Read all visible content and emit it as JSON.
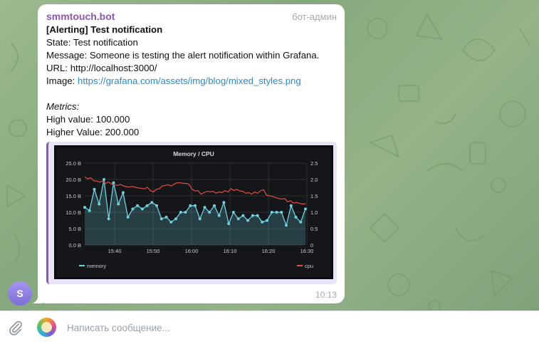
{
  "message": {
    "sender": "smmtouch.bot",
    "role_tag": "бот-админ",
    "avatar_letter": "S",
    "title": "[Alerting] Test notification",
    "state": "State: Test notification",
    "message_line": "Message: Someone is testing the alert notification within Grafana.",
    "url_line": "URL: http://localhost:3000/",
    "image_prefix": "Image: ",
    "image_link": "https://grafana.com/assets/img/blog/mixed_styles.png",
    "metrics_label": "Metrics:",
    "high_value": "High value: 100.000",
    "higher_value": "Higher Value: 200.000",
    "time": "10:13"
  },
  "input": {
    "placeholder": "Написать сообщение..."
  },
  "colors": {
    "sender": "#8e55b8",
    "link": "#2a8ad0",
    "memory_series": "#6ed0e0",
    "cpu_series": "#e24d42",
    "chart_bg": "#141619"
  },
  "chart_data": {
    "type": "line",
    "title": "Memory / CPU",
    "x_ticks": [
      "15:40",
      "15:50",
      "16:00",
      "16:10",
      "16:20",
      "16:30"
    ],
    "y_left_ticks": [
      "0.0 B",
      "5.0 B",
      "10.0 B",
      "15.0 B",
      "20.0 B",
      "25.0 B"
    ],
    "y_right_ticks": [
      "0",
      "0.5",
      "1.0",
      "1.5",
      "2.0",
      "2.5"
    ],
    "ylim_left": [
      0,
      25
    ],
    "ylim_right": [
      0,
      2.5
    ],
    "grid": true,
    "legend_position": "bottom",
    "series": [
      {
        "name": "memory",
        "axis": "left",
        "values": [
          11.5,
          11,
          12.5,
          10,
          10.5,
          15,
          13,
          12,
          17,
          11,
          8,
          11.5,
          12.5,
          15,
          11,
          13,
          20,
          10,
          16,
          15,
          8,
          11,
          14,
          10,
          19,
          11,
          13,
          16,
          12.5,
          12.5,
          8,
          14,
          16,
          13,
          12,
          7,
          8.5,
          12,
          13,
          17,
          11,
          12,
          17,
          8,
          12,
          15,
          5,
          11,
          11,
          13,
          8,
          16,
          12,
          15,
          10,
          12,
          13,
          10,
          15,
          16,
          12,
          14,
          6.5,
          7.5,
          8,
          10,
          12,
          4.5,
          8.5,
          9.5,
          7.5,
          10,
          7,
          4,
          9,
          10,
          8,
          14,
          13,
          10,
          10,
          12,
          8,
          13,
          10,
          11,
          14,
          8,
          12,
          10,
          9,
          10,
          12,
          6,
          7,
          7.5,
          8,
          11,
          6,
          11,
          11.5,
          10,
          9,
          14,
          10,
          11,
          9,
          14,
          12,
          9,
          10,
          11,
          9,
          10,
          10,
          8,
          13,
          11,
          12,
          7,
          6.5,
          9,
          10,
          11,
          10,
          11,
          12,
          8,
          8,
          12,
          10,
          11,
          9,
          6,
          11,
          10,
          7.5,
          8,
          8,
          10,
          9,
          11,
          11,
          9,
          9,
          10,
          12,
          10,
          7,
          10,
          13,
          10,
          7.5,
          12,
          10,
          11,
          10,
          10,
          11,
          12,
          10,
          13,
          11,
          9,
          10,
          11,
          10,
          8,
          6,
          7.5,
          8,
          10,
          12,
          10,
          9.5,
          11,
          8.5,
          7,
          8,
          9,
          7,
          8,
          6,
          10,
          11
        ]
      },
      {
        "name": "cpu",
        "axis": "right",
        "values": [
          2.08,
          2.02,
          2.05,
          1.96,
          1.95,
          1.92,
          1.95,
          1.88,
          1.92,
          1.86,
          1.83,
          1.82,
          1.85,
          1.8,
          1.78,
          1.77,
          1.79,
          1.76,
          1.74,
          1.73,
          1.71,
          1.76,
          1.66,
          1.62,
          1.7,
          1.72,
          1.8,
          1.82,
          1.84,
          1.8,
          1.86,
          1.9,
          1.9,
          1.88,
          1.88,
          1.85,
          1.7,
          1.65,
          1.66,
          1.55,
          1.6,
          1.64,
          1.62,
          1.64,
          1.58,
          1.62,
          1.6,
          1.66,
          1.62,
          1.72,
          1.66,
          1.7,
          1.65,
          1.64,
          1.58,
          1.6,
          1.55,
          1.62,
          1.58,
          1.66,
          1.68,
          1.52,
          1.5,
          1.48,
          1.45,
          1.42,
          1.4,
          1.42,
          1.32,
          1.35,
          1.28,
          1.3,
          1.27,
          1.25,
          1.26
        ]
      }
    ]
  }
}
